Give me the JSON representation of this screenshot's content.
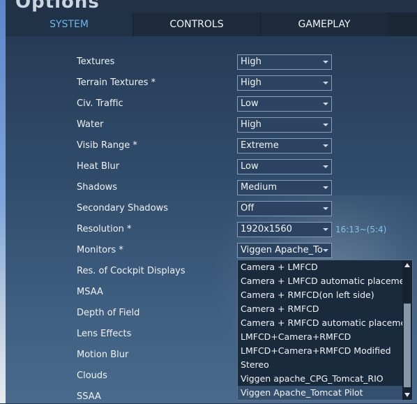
{
  "window": {
    "title": "Options"
  },
  "tabs": [
    {
      "label": "SYSTEM",
      "active": true
    },
    {
      "label": "CONTROLS",
      "active": false
    },
    {
      "label": "GAMEPLAY",
      "active": false
    }
  ],
  "settings": [
    {
      "label": "Textures",
      "value": "High"
    },
    {
      "label": "Terrain Textures *",
      "value": "High"
    },
    {
      "label": "Civ. Traffic",
      "value": "Low"
    },
    {
      "label": "Water",
      "value": "High"
    },
    {
      "label": "Visib Range *",
      "value": "Extreme"
    },
    {
      "label": "Heat Blur",
      "value": "Low"
    },
    {
      "label": "Shadows",
      "value": "Medium"
    },
    {
      "label": "Secondary Shadows",
      "value": "Off"
    },
    {
      "label": "Resolution *",
      "value": "1920x1560"
    },
    {
      "label": "Monitors *",
      "value": "Viggen Apache_Tom"
    },
    {
      "label": "Res. of Cockpit Displays",
      "value": ""
    },
    {
      "label": "MSAA",
      "value": ""
    },
    {
      "label": "Depth of Field",
      "value": ""
    },
    {
      "label": "Lens Effects",
      "value": ""
    },
    {
      "label": "Motion Blur",
      "value": ""
    },
    {
      "label": "Clouds",
      "value": ""
    },
    {
      "label": "SSAA",
      "value": ""
    }
  ],
  "aspect_ratio": "16:13~(5:4)",
  "monitors_dropdown": {
    "options": [
      "Camera + LMFCD",
      "Camera + LMFCD automatic placement",
      "Camera + RMFCD(on left side)",
      "Camera + RMFCD",
      "Camera + RMFCD automatic placement",
      "LMFCD+Camera+RMFCD",
      "LMFCD+Camera+RMFCD Modified",
      "Stereo",
      "Viggen  apache_CPG_Tomcat_RIO",
      "Viggen Apache_Tomcat Pilot"
    ],
    "selected": "Viggen Apache_Tomcat Pilot"
  },
  "colors": {
    "accent": "#6fb6ea",
    "panel": "#1c2a3b",
    "aspect_text": "#7fc3ee"
  }
}
